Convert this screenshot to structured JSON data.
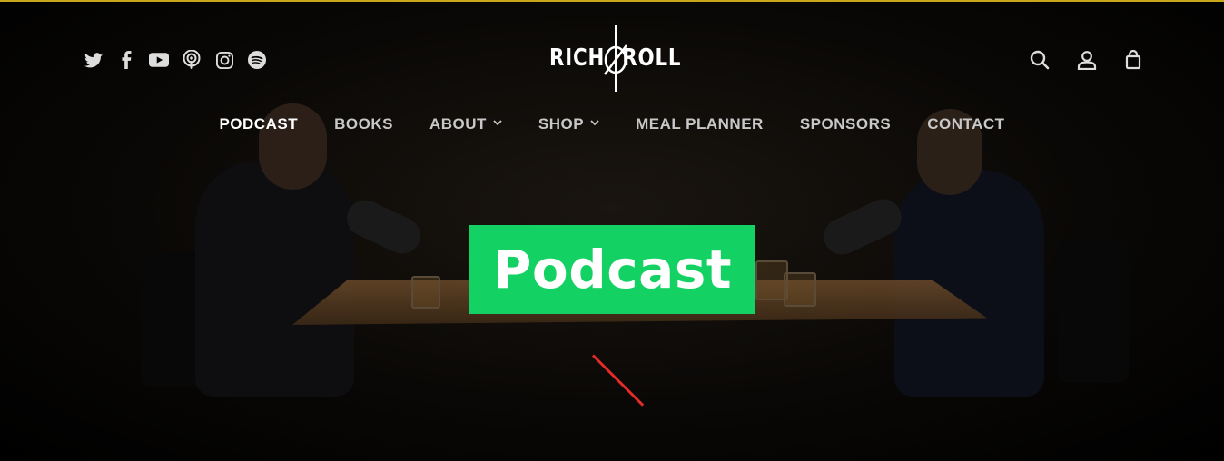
{
  "brand": {
    "logo_left": "RICH",
    "logo_right": "ROLL",
    "accent_color": "#14d164",
    "top_border_color": "#c9a61a"
  },
  "social_links": [
    {
      "name": "twitter-icon"
    },
    {
      "name": "facebook-icon"
    },
    {
      "name": "youtube-icon"
    },
    {
      "name": "podcast-icon"
    },
    {
      "name": "instagram-icon"
    },
    {
      "name": "spotify-icon"
    }
  ],
  "utility_icons": [
    "search-icon",
    "account-icon",
    "cart-icon"
  ],
  "nav": {
    "items": [
      {
        "label": "PODCAST",
        "active": true
      },
      {
        "label": "BOOKS"
      },
      {
        "label": "ABOUT",
        "dropdown": true
      },
      {
        "label": "SHOP",
        "dropdown": true
      },
      {
        "label": "MEAL PLANNER"
      },
      {
        "label": "SPONSORS"
      },
      {
        "label": "CONTACT"
      }
    ]
  },
  "hero": {
    "title": "Podcast"
  }
}
